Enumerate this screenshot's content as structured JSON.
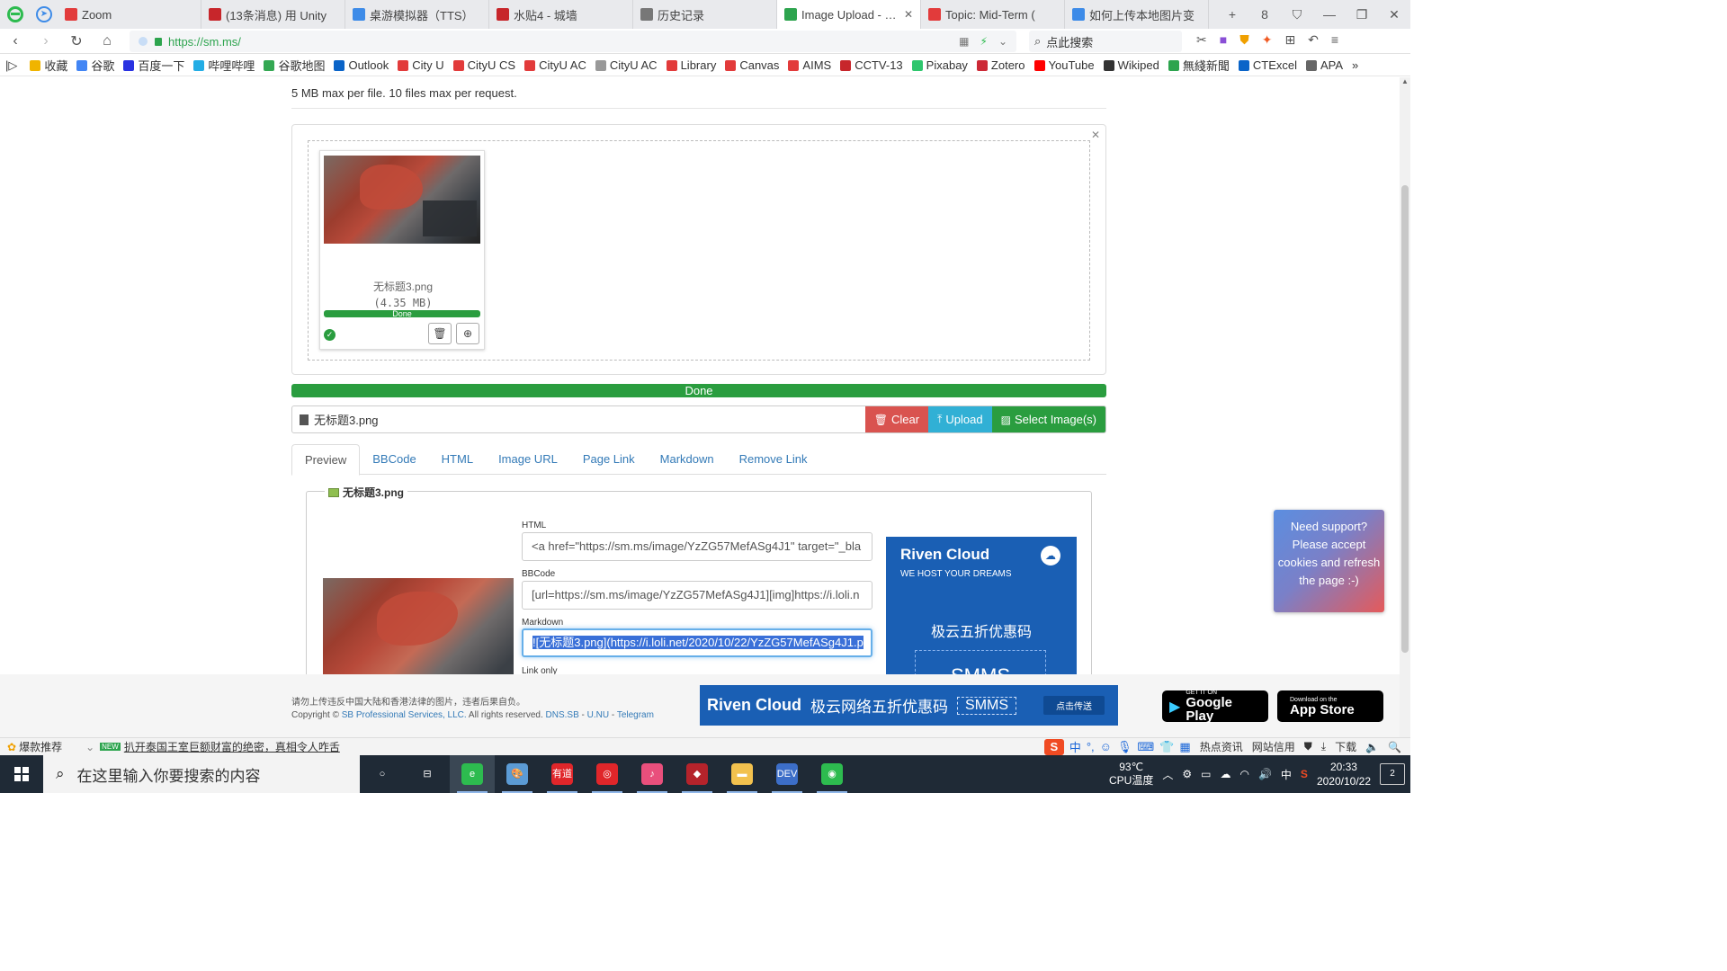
{
  "browser": {
    "tabs": [
      {
        "label": "Zoom",
        "color": "#e23b3b",
        "icon": "zoom-icon"
      },
      {
        "label": "(13条消息) 用 Unity",
        "color": "#c7262b",
        "icon": "csdn-icon"
      },
      {
        "label": "桌游模拟器（TTS）",
        "color": "#3d8be8",
        "icon": "tv-icon"
      },
      {
        "label": "水贴4 - 城墙",
        "color": "#c7262b",
        "icon": "forum-icon"
      },
      {
        "label": "历史记录",
        "color": "#777777",
        "icon": "history-icon"
      },
      {
        "label": "Image Upload - SM",
        "color": "#2da44e",
        "icon": "bar-chart-icon"
      },
      {
        "label": "Topic: Mid-Term (",
        "color": "#e23b3b",
        "icon": "canvas-icon"
      },
      {
        "label": "如何上传本地图片变",
        "color": "#3d8be8",
        "icon": "zhihu-icon"
      }
    ],
    "active_tab_index": 5,
    "nav_badge": "",
    "window_controls": [
      "+",
      "8",
      "⛉",
      "—",
      "❐",
      "✕"
    ],
    "url": "https://sm.ms/",
    "search_placeholder": "点此搜索"
  },
  "bookmarks": [
    {
      "label": "收藏",
      "icon": "star-icon",
      "color": "#f0b400"
    },
    {
      "label": "谷歌",
      "icon": "google-icon",
      "color": "#4285f4"
    },
    {
      "label": "百度一下",
      "icon": "baidu-icon",
      "color": "#2932e1"
    },
    {
      "label": "哔哩哔哩",
      "icon": "bilibili-icon",
      "color": "#23ade5"
    },
    {
      "label": "谷歌地图",
      "icon": "map-pin-icon",
      "color": "#34a853"
    },
    {
      "label": "Outlook",
      "icon": "outlook-icon",
      "color": "#0a64c8"
    },
    {
      "label": "City U",
      "icon": "canvas-icon",
      "color": "#e23b3b"
    },
    {
      "label": "CityU CS",
      "icon": "canvas-icon",
      "color": "#e23b3b"
    },
    {
      "label": "CityU AC",
      "icon": "canvas-icon",
      "color": "#e23b3b"
    },
    {
      "label": "CityU AC",
      "icon": "page-icon",
      "color": "#999999"
    },
    {
      "label": "Library",
      "icon": "canvas-icon",
      "color": "#e23b3b"
    },
    {
      "label": "Canvas",
      "icon": "canvas-icon",
      "color": "#e23b3b"
    },
    {
      "label": "AIMS",
      "icon": "canvas-icon",
      "color": "#e23b3b"
    },
    {
      "label": "CCTV-13",
      "icon": "cctv-icon",
      "color": "#c7262b"
    },
    {
      "label": "Pixabay",
      "icon": "pixabay-icon",
      "color": "#2ec66d"
    },
    {
      "label": "Zotero",
      "icon": "zotero-icon",
      "color": "#cc2936"
    },
    {
      "label": "YouTube",
      "icon": "youtube-icon",
      "color": "#ff0000"
    },
    {
      "label": "Wikiped",
      "icon": "wikipedia-icon",
      "color": "#333333"
    },
    {
      "label": "無綫新聞",
      "icon": "tvb-icon",
      "color": "#2da44e"
    },
    {
      "label": "CTExcel",
      "icon": "ctexcel-icon",
      "color": "#0a64c8"
    },
    {
      "label": "APA",
      "icon": "apa-icon",
      "color": "#666666"
    }
  ],
  "page": {
    "limit_text": "5 MB max per file. 10 files max per request.",
    "file": {
      "name": "无标题3.png",
      "size": "(4.35 MB)",
      "progress_label": "Done",
      "progress": 1.0
    },
    "main_progress_label": "Done",
    "file_row_name": "无标题3.png",
    "buttons": {
      "clear": "Clear",
      "upload": "Upload",
      "select": "Select Image(s)"
    },
    "tabs": [
      "Preview",
      "BBCode",
      "HTML",
      "Image URL",
      "Page Link",
      "Markdown",
      "Remove Link"
    ],
    "active_tab": "Preview",
    "legend": "无标题3.png",
    "fields": {
      "html_label": "HTML",
      "html_value": "<a href=\"https://sm.ms/image/YzZG57MefASg4J1\" target=\"_bla",
      "bbcode_label": "BBCode",
      "bbcode_value": "[url=https://sm.ms/image/YzZG57MefASg4J1][img]https://i.loli.n",
      "markdown_label": "Markdown",
      "markdown_value": "![无标题3.png](https://i.loli.net/2020/10/22/YzZG57MefASg4J1.p",
      "linkonly_label": "Link only"
    },
    "ad": {
      "title": "Riven Cloud",
      "subtitle": "WE HOST YOUR DREAMS",
      "cn_text": "极云五折优惠码",
      "code": "SMMS"
    },
    "support_text": "Need support? Please accept cookies and refresh the page :-)",
    "footer": {
      "warning": "请勿上传违反中国大陆和香港法律的图片，违者后果自负。",
      "copyright_prefix": "Copyright ©",
      "company": "SB Professional Services, LLC.",
      "rights": "All rights reserved.",
      "links": [
        "DNS.SB",
        "U.NU",
        "Telegram"
      ],
      "banner_brand": "Riven Cloud",
      "banner_text": "极云网络五折优惠码",
      "banner_code": "SMMS",
      "banner_button": "点击传送",
      "google_top": "GET IT ON",
      "google_bottom": "Google Play",
      "apple_top": "Download on the",
      "apple_bottom": "App Store"
    }
  },
  "statusbar": {
    "left1": "爆款推荐",
    "hot_badge": "NEW",
    "news": "扒开泰国王室巨额财富的绝密，真相令人咋舌",
    "right_items": [
      "热点资讯",
      "网站信用",
      "下载"
    ]
  },
  "taskbar": {
    "search_placeholder": "在这里输入你要搜索的内容",
    "apps": [
      {
        "icon": "cortana-icon",
        "label": "○"
      },
      {
        "icon": "task-view-icon",
        "label": "⊟"
      },
      {
        "icon": "browser-icon",
        "label": "e",
        "color": "#2dbb4f"
      },
      {
        "icon": "paint-icon",
        "label": "🎨",
        "color": "#5b9bd5"
      },
      {
        "icon": "youdao-icon",
        "label": "有道",
        "color": "#e0262a"
      },
      {
        "icon": "netease-music-icon",
        "label": "◎",
        "color": "#e0262a"
      },
      {
        "icon": "itunes-icon",
        "label": "♪",
        "color": "#e94f7c"
      },
      {
        "icon": "app-icon",
        "label": "◆",
        "color": "#b5232b"
      },
      {
        "icon": "file-explorer-icon",
        "label": "▬",
        "color": "#f2c14e"
      },
      {
        "icon": "dev-icon",
        "label": "DEV",
        "color": "#3c6ec8"
      },
      {
        "icon": "wechat-icon",
        "label": "◉",
        "color": "#2dbb4f"
      }
    ],
    "temp": "93℃",
    "temp_label": "CPU温度",
    "ime": "中",
    "time": "20:33",
    "date": "2020/10/22",
    "notif_count": "2"
  }
}
